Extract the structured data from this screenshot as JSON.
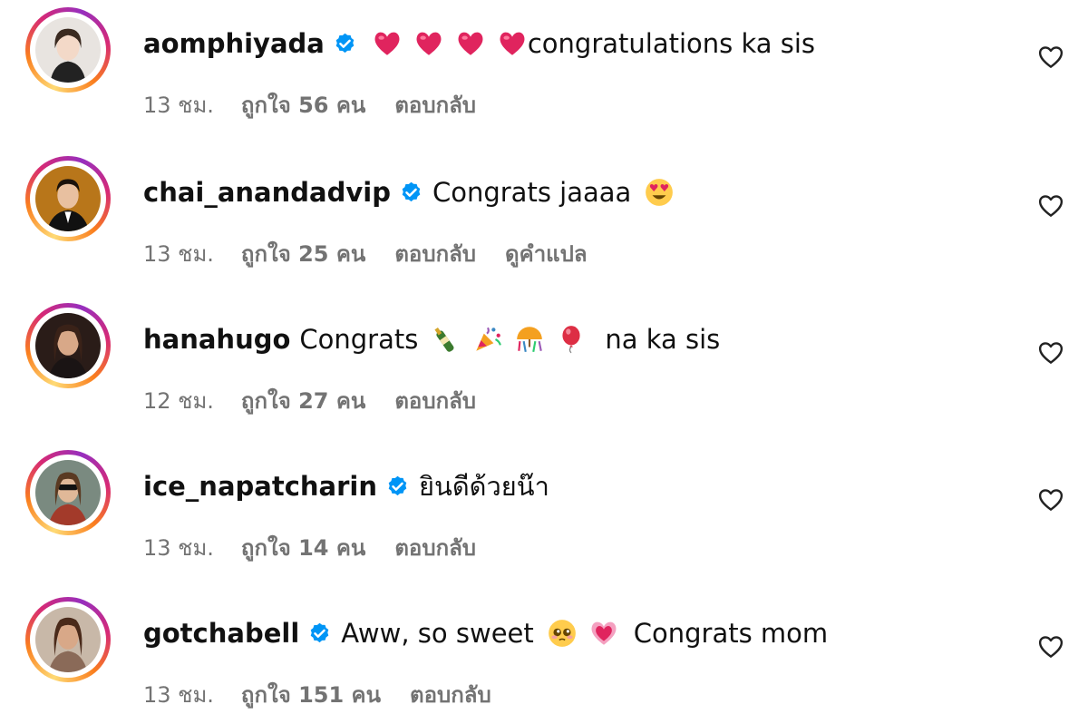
{
  "colors": {
    "meta_text": "#737373",
    "verified_blue": "#0095f6",
    "text": "#111111"
  },
  "comments": [
    {
      "username": "aomphiyada",
      "verified": true,
      "text_before": "",
      "text_after": "congratulations ka sis",
      "emojis": [
        "heart-emoji",
        "heart-emoji",
        "heart-emoji",
        "heart-emoji"
      ],
      "time": "13 ชม.",
      "likes": "ถูกใจ 56 คน",
      "reply": "ตอบกลับ",
      "translate": ""
    },
    {
      "username": "chai_anandadvip",
      "verified": true,
      "text_before": "Congrats jaaaa",
      "text_after": "",
      "emojis": [
        "heart-eyes-emoji"
      ],
      "time": "13 ชม.",
      "likes": "ถูกใจ 25 คน",
      "reply": "ตอบกลับ",
      "translate": "ดูคำแปล"
    },
    {
      "username": "hanahugo",
      "verified": false,
      "text_before": "Congrats",
      "text_after": "na ka sis",
      "emojis": [
        "champagne-emoji",
        "party-popper-emoji",
        "confetti-ball-emoji",
        "balloon-emoji"
      ],
      "time": "12 ชม.",
      "likes": "ถูกใจ 27 คน",
      "reply": "ตอบกลับ",
      "translate": ""
    },
    {
      "username": "ice_napatcharin",
      "verified": true,
      "text_before": "ยินดีด้วยน๊า",
      "text_after": "",
      "emojis": [],
      "time": "13 ชม.",
      "likes": "ถูกใจ 14 คน",
      "reply": "ตอบกลับ",
      "translate": ""
    },
    {
      "username": "gotchabell",
      "verified": true,
      "text_before": "Aww, so sweet",
      "text_after": "Congrats mom",
      "emojis": [
        "pleading-face-emoji",
        "growing-heart-emoji"
      ],
      "time": "13 ชม.",
      "likes": "ถูกใจ 151 คน",
      "reply": "ตอบกลับ",
      "translate": ""
    }
  ]
}
